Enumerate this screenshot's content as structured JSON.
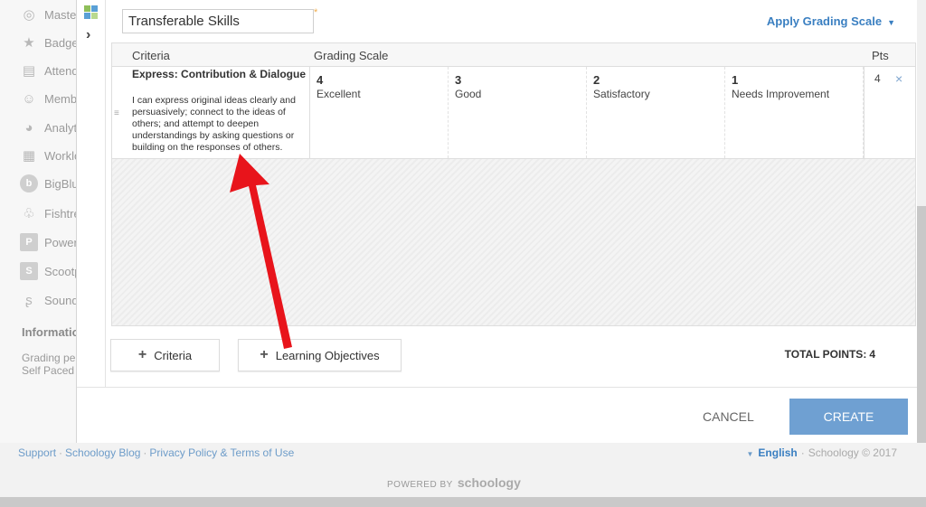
{
  "sidebar": {
    "items": [
      {
        "label": "Mastery",
        "icon": "mastery-icon"
      },
      {
        "label": "Badges",
        "icon": "badge-icon"
      },
      {
        "label": "Attendance",
        "icon": "attendance-icon"
      },
      {
        "label": "Members",
        "icon": "members-icon"
      },
      {
        "label": "Analytics",
        "icon": "analytics-icon"
      },
      {
        "label": "Workload",
        "icon": "workload-icon"
      },
      {
        "label": "BigBlueButton",
        "icon": "bigbluebutton-icon"
      },
      {
        "label": "Fishtree",
        "icon": "fishtree-icon"
      },
      {
        "label": "PowerSchool",
        "icon": "powerschool-icon"
      },
      {
        "label": "Scootpad",
        "icon": "scootpad-icon"
      },
      {
        "label": "SoundTrap",
        "icon": "soundtrap-icon"
      }
    ],
    "info_heading": "Information",
    "grading_period": "Grading periods",
    "self_paced": "Self Paced"
  },
  "modal": {
    "title_value": "Transferable Skills",
    "required_mark": "*",
    "apply_grading_scale": "Apply Grading Scale",
    "columns": {
      "criteria": "Criteria",
      "grading_scale": "Grading Scale",
      "pts": "Pts"
    },
    "criterion": {
      "title": "Express: Contribution & Dialogue",
      "description": "I can express original ideas clearly and persuasively; connect to the ideas of others; and attempt to deepen understandings by asking questions or building on the responses of others.",
      "points": "4",
      "delete_symbol": "×",
      "levels": [
        {
          "points": "4",
          "label": "Excellent"
        },
        {
          "points": "3",
          "label": "Good"
        },
        {
          "points": "2",
          "label": "Satisfactory"
        },
        {
          "points": "1",
          "label": "Needs Improvement"
        }
      ]
    },
    "add_criteria_label": "Criteria",
    "add_objectives_label": "Learning Objectives",
    "total_points_label": "TOTAL POINTS:",
    "total_points_value": "4",
    "cancel_label": "CANCEL",
    "create_label": "CREATE"
  },
  "footer": {
    "links": [
      "Support",
      "Schoology Blog",
      "Privacy Policy & Terms of Use"
    ],
    "language": "English",
    "copyright": "Schoology © 2017",
    "powered_by": "POWERED BY",
    "brand": "schoology"
  },
  "colors": {
    "accent": "#3a7fc1",
    "create_button": "#6fa0d2",
    "annotation_arrow": "#e8141b"
  }
}
